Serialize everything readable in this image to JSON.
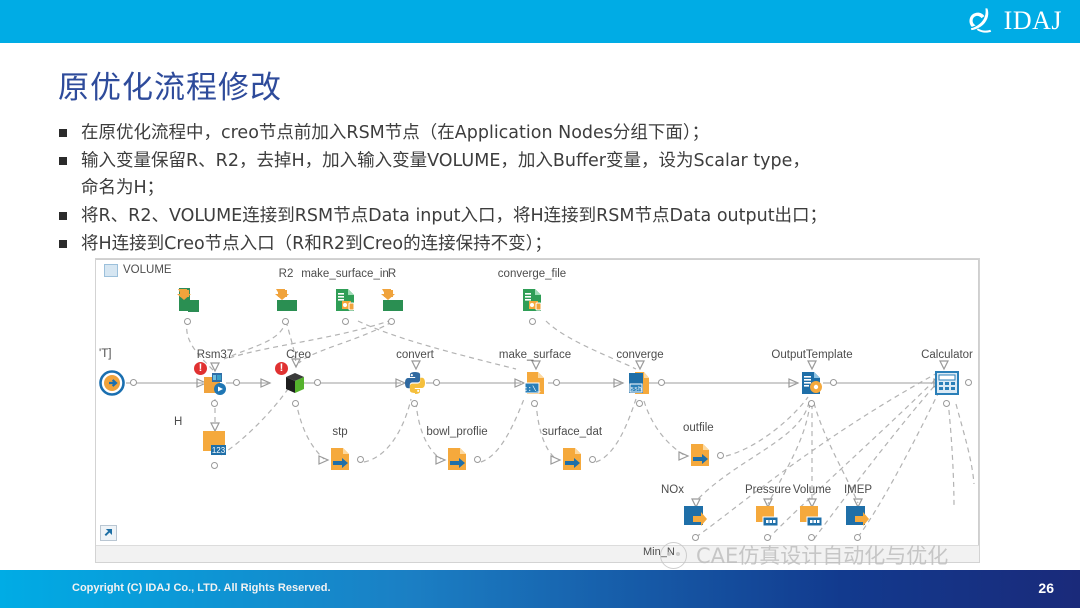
{
  "header": {
    "brand": "IDAJ",
    "logo_icon": "idaj-bird-logo",
    "bar_color": "#00ace5"
  },
  "title": "原优化流程修改",
  "bullets": [
    {
      "text": "在原优化流程中，creo节点前加入RSM节点（在Application Nodes分组下面）；",
      "continuation": ""
    },
    {
      "text": "输入变量保留R、R2，去掉H，加入输入变量VOLUME，加入Buffer变量，设为Scalar type，",
      "continuation": "命名为H；"
    },
    {
      "text": "将R、R2、VOLUME连接到RSM节点Data input入口，将H连接到RSM节点Data output出口；",
      "continuation": ""
    },
    {
      "text": "将H连接到Creo节点入口（R和R2到Creo的连接保持不变）；",
      "continuation": ""
    }
  ],
  "canvas": {
    "corner_label": "'T]",
    "top_left_icon": "document-icon",
    "expand_icon": "expand-arrow-icon",
    "nodes": [
      {
        "id": "start",
        "label": "",
        "icon": "start-circle-icon"
      },
      {
        "id": "volume",
        "label": "VOLUME",
        "icon": "input-variable-icon"
      },
      {
        "id": "r2",
        "label": "R2",
        "icon": "input-variable-icon"
      },
      {
        "id": "r",
        "label": "R",
        "icon": "input-variable-icon"
      },
      {
        "id": "rsm37",
        "label": "Rsm37",
        "icon": "rsm-node-icon",
        "status": "!"
      },
      {
        "id": "creo",
        "label": "Creo",
        "icon": "creo-cube-icon",
        "status": "!"
      },
      {
        "id": "h",
        "label": "H",
        "icon": "scalar-buffer-icon"
      },
      {
        "id": "stp",
        "label": "stp",
        "icon": "file-output-icon"
      },
      {
        "id": "convert",
        "label": "convert",
        "icon": "python-icon"
      },
      {
        "id": "bowl_profile",
        "label": "bowl_proflie",
        "icon": "file-output-icon"
      },
      {
        "id": "make_surface_in",
        "label": "make_surface_in",
        "icon": "template-file-icon"
      },
      {
        "id": "make_surface",
        "label": "make_surface",
        "icon": "cmd-file-icon"
      },
      {
        "id": "surface_dat",
        "label": "surface_dat",
        "icon": "file-output-icon"
      },
      {
        "id": "converge_file",
        "label": "converge_file",
        "icon": "template-file-icon"
      },
      {
        "id": "converge",
        "label": "converge",
        "icon": "ssh-file-icon"
      },
      {
        "id": "outfile",
        "label": "outfile",
        "icon": "file-output-icon"
      },
      {
        "id": "outputtemplate",
        "label": "OutputTemplate",
        "icon": "output-template-icon"
      },
      {
        "id": "nox",
        "label": "NOx",
        "icon": "output-variable-icon"
      },
      {
        "id": "pressure",
        "label": "Pressure",
        "icon": "array-variable-icon"
      },
      {
        "id": "volume_out",
        "label": "Volume",
        "icon": "array-variable-icon"
      },
      {
        "id": "imep",
        "label": "IMEP",
        "icon": "output-variable-icon"
      },
      {
        "id": "calculator",
        "label": "Calculator",
        "icon": "calculator-icon"
      },
      {
        "id": "min_n",
        "label": "Min_N",
        "icon": ""
      }
    ]
  },
  "watermark": {
    "text": "CAE仿真设计自动化与优化",
    "icon": "wechat-icon"
  },
  "footer": {
    "copyright": "Copyright (C)  IDAJ Co., LTD. All Rights Reserved.",
    "page_number": "26"
  }
}
